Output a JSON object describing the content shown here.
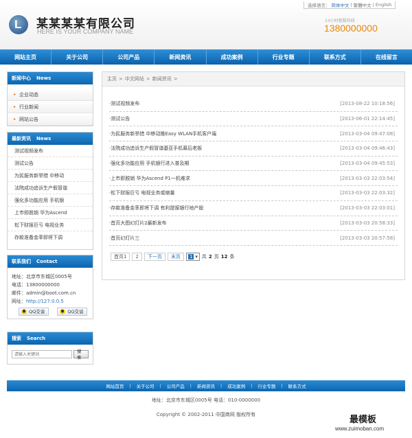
{
  "header": {
    "company_name": "某某某某有限公司",
    "company_en": "HERE IS YOUR COMPANY NAME",
    "logo_letter": "L",
    "lang_label": "选择语言：",
    "lang_items": [
      "简体中文",
      "繁體中文",
      "English"
    ],
    "hotline_label": "24小时客服热线",
    "hotline_number": "1380000000"
  },
  "nav": [
    "网站主页",
    "关于公司",
    "公司产品",
    "新闻资讯",
    "成功案例",
    "行业专题",
    "联系方式",
    "在线留言"
  ],
  "sidebar": {
    "news_center": {
      "title": "新闻中心",
      "title_en": "News",
      "items": [
        "企业动态",
        "行业新闻",
        "网站公告"
      ]
    },
    "latest": {
      "title": "最新资讯",
      "title_en": "News",
      "items": [
        "测试视频发布",
        "测试公告",
        "为民服务新举措 中移动",
        "法院成功追诉生产假冒谐",
        "强化多功能应用 手机银",
        "上市即脱销 华为Ascend",
        "松下财报巨亏 电视业务",
        "存款准备金率即将下调"
      ]
    },
    "contact": {
      "title": "联系我们",
      "title_en": "Contact",
      "address": "地址：北京市东城区0005号",
      "phone": "电话：13800000000",
      "email": "邮件：admin@boot.com.cn",
      "site_label": "网址：",
      "site_url": "http://127.0.0.5",
      "qq_buttons": [
        "QQ交谈",
        "QQ交谈"
      ]
    },
    "search": {
      "title": "搜索",
      "title_en": "Search",
      "placeholder": "请输入关键词",
      "button": "搜索"
    }
  },
  "main": {
    "breadcrumb": [
      "主页",
      "中文网站",
      "新闻资讯"
    ],
    "news": [
      {
        "title": "·测试视频发布",
        "date": "[2013-08-22 10:18:56]"
      },
      {
        "title": "·测试公告",
        "date": "[2013-06-01 22:14:45]"
      },
      {
        "title": "·为民服务新举措 中移动推Easy WLAN手机客户端",
        "date": "[2013-03-04 09:47:08]"
      },
      {
        "title": "·法院成功追诉生产假冒谐基亚手机幕后老板",
        "date": "[2013-03-04 09:46:43]"
      },
      {
        "title": "·强化多功能应用 手机银行进入普及期",
        "date": "[2013-03-04 09:45:53]"
      },
      {
        "title": "·上市即脱销 华为Ascend P1一机难求",
        "date": "[2013-03-03 22:03:54]"
      },
      {
        "title": "·松下财报巨亏 电视业务或缩量",
        "date": "[2013-03-03 22:03:32]"
      },
      {
        "title": "·存款准备金率即将下调 有利提振银行地产股",
        "date": "[2013-03-03 22:03:01]"
      },
      {
        "title": "·首页大图幻灯片2最新发布",
        "date": "[2013-03-03 20:58:33]"
      },
      {
        "title": "·首页幻灯片三",
        "date": "[2013-03-03 20:57:58]"
      }
    ],
    "pager": {
      "first": "首页1",
      "page2": "2",
      "next": "下一页",
      "last": "末页",
      "select_value": "1",
      "total_prefix": "共",
      "total_pages": "2",
      "pages_word": "页",
      "total_items": "12",
      "items_word": "条"
    }
  },
  "footer": {
    "links": [
      "网站首页",
      "关于公司",
      "公司产品",
      "新闻资讯",
      "成功案例",
      "行业专题",
      "联系方式"
    ],
    "address": "地址：北京市东城区0005号 电话：010-0000000",
    "copyright": "Copyright © 2002-2011 中国商网 版权所有"
  },
  "watermark": {
    "cn": "最模板",
    "url": "www.zuimoban.com"
  },
  "colors": {
    "nav_blue": "#0b66b0",
    "hotline_orange": "#e8860a",
    "link_blue": "#2a6fb5"
  }
}
